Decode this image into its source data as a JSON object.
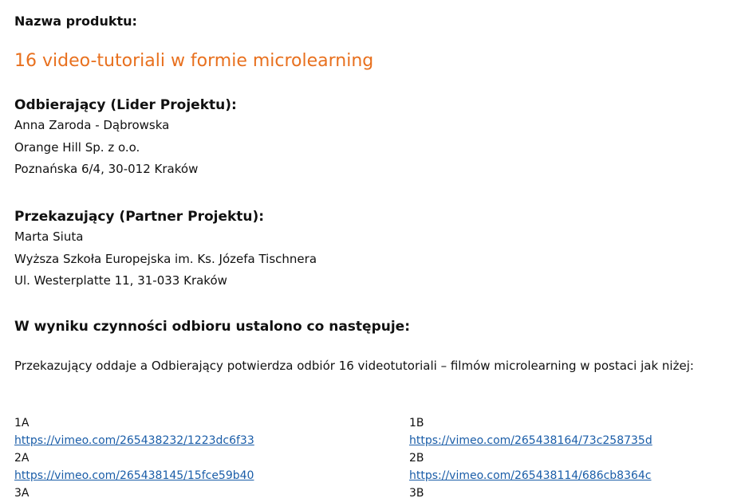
{
  "product": {
    "label": "Nazwa produktu:",
    "name": "16 video-tutoriali w formie microlearning"
  },
  "receiver": {
    "heading": "Odbierający (Lider Projektu):",
    "lines": [
      "Anna Zaroda - Dąbrowska",
      "Orange Hill Sp. z o.o.",
      "Poznańska 6/4, 30-012 Kraków"
    ]
  },
  "transferor": {
    "heading": "Przekazujący (Partner Projektu):",
    "lines": [
      "Marta Siuta",
      "Wyższa Szkoła Europejska im. Ks. Józefa Tischnera",
      "Ul. Westerplatte 11, 31-033 Kraków"
    ]
  },
  "result": {
    "heading": "W wyniku czynności odbioru ustalono co następuje:",
    "paragraph": "Przekazujący oddaje a Odbierający potwierdza odbiór 16 videotutoriali – filmów microlearning w postaci jak niżej:"
  },
  "videos": {
    "left": [
      {
        "code": "1A",
        "url": "https://vimeo.com/265438232/1223dc6f33"
      },
      {
        "code": "2A",
        "url": "https://vimeo.com/265438145/15fce59b40"
      },
      {
        "code": "3A",
        "url": ""
      }
    ],
    "right": [
      {
        "code": "1B",
        "url": "https://vimeo.com/265438164/73c258735d"
      },
      {
        "code": "2B",
        "url": "https://vimeo.com/265438114/686cb8364c"
      },
      {
        "code": "3B",
        "url": ""
      }
    ]
  },
  "colors": {
    "accent": "#e8701e",
    "link": "#1a5da8"
  }
}
